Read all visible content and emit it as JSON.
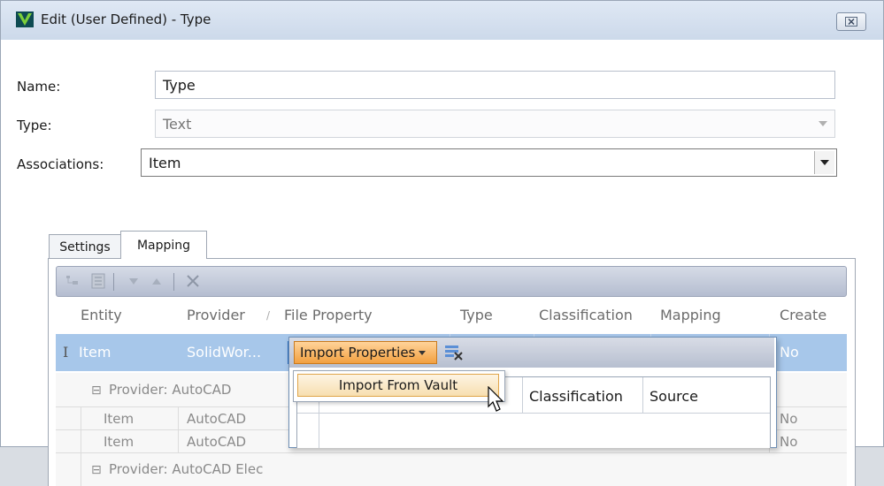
{
  "window": {
    "title": "Edit (User Defined) - Type",
    "close_glyph": "⊠"
  },
  "form": {
    "name_label": "Name:",
    "name_value": "Type",
    "type_label": "Type:",
    "type_value": "Text",
    "assoc_label": "Associations:",
    "assoc_value": "Item"
  },
  "tabs": [
    {
      "label": "Settings",
      "active": false
    },
    {
      "label": "Mapping",
      "active": true
    }
  ],
  "grid": {
    "columns": [
      "Entity",
      "Provider",
      "File Property",
      "Type",
      "Classification",
      "Mapping",
      "Create"
    ],
    "sort_indicator": "/",
    "selected_row": {
      "cursor": "I",
      "entity": "Item",
      "provider": "SolidWor...",
      "create": "No"
    },
    "groups": [
      {
        "header": "Provider: AutoCAD",
        "rows": [
          {
            "entity": "Item",
            "provider": "AutoCAD",
            "create": "No"
          },
          {
            "entity": "Item",
            "provider": "AutoCAD",
            "create": "No"
          }
        ]
      },
      {
        "header": "Provider: AutoCAD Elec",
        "rows": []
      }
    ],
    "group_toggle": "⊟"
  },
  "popup": {
    "import_button": "Import Properties",
    "menu_item": "Import From Vault",
    "inner_columns": [
      "Classification",
      "Source"
    ]
  },
  "colors": {
    "selection": "#a7c7ea",
    "accent_orange": "#f2a040",
    "toolbar": "#b5bdd0"
  }
}
